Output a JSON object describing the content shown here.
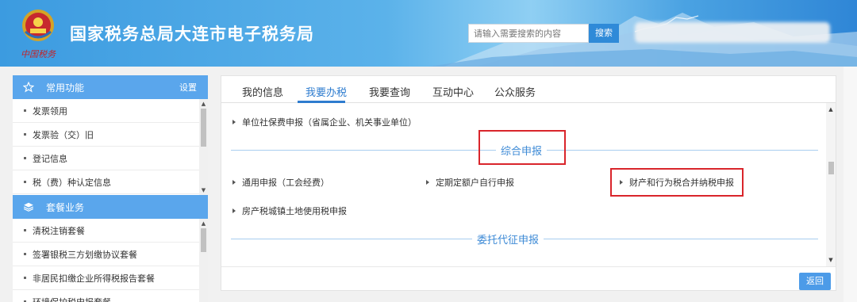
{
  "header": {
    "site_title": "国家税务总局大连市电子税务局",
    "emblem_signature": "中国税务",
    "search_placeholder": "请输入需要搜索的内容",
    "search_button": "搜索",
    "colors": {
      "primary": "#3c9be0",
      "accent": "#2e7ccf",
      "highlight_box": "#d9252b"
    }
  },
  "sidebar": {
    "common": {
      "title": "常用功能",
      "icon": "star-outline-icon",
      "settings_label": "设置",
      "items": [
        "发票领用",
        "发票验（交）旧",
        "登记信息",
        "税（费）种认定信息"
      ]
    },
    "package": {
      "title": "套餐业务",
      "icon": "layers-icon",
      "items": [
        "清税注销套餐",
        "签署银税三方划缴协议套餐",
        "非居民扣缴企业所得税报告套餐",
        "环境保护税申报套餐"
      ]
    }
  },
  "main": {
    "tabs": [
      {
        "label": "我的信息",
        "active": false
      },
      {
        "label": "我要办税",
        "active": true
      },
      {
        "label": "我要查询",
        "active": false
      },
      {
        "label": "互动中心",
        "active": false
      },
      {
        "label": "公众服务",
        "active": false
      }
    ],
    "top_link": "单位社保费申报（省属企业、机关事业单位）",
    "section1": {
      "title": "综合申报",
      "links": [
        "通用申报（工会经费）",
        "定期定额户自行申报",
        "财产和行为税合并纳税申报",
        "房产税城镇土地使用税申报"
      ]
    },
    "section2": {
      "title": "委托代征申报"
    },
    "back_button": "返回"
  }
}
